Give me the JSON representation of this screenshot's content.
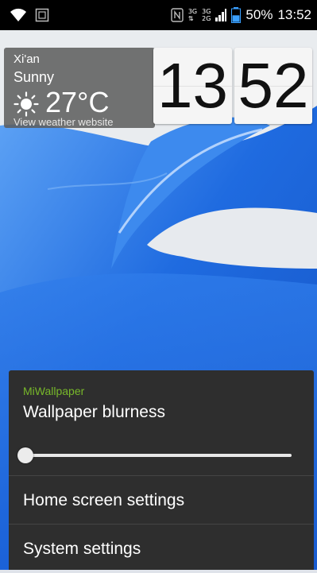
{
  "status_bar": {
    "battery_text": "50%",
    "time": "13:52",
    "network_top": "3G",
    "network_bottom": "2G",
    "network_label_left": "3G",
    "network_arrows": "⇅",
    "icons": [
      "wifi-icon",
      "screenshot-icon",
      "nfc-icon",
      "signal-icon",
      "battery-icon"
    ],
    "battery_level": 0.5
  },
  "weather": {
    "city": "Xi'an",
    "condition": "Sunny",
    "temperature": "27°C",
    "link": "View weather website",
    "icon": "sun-icon"
  },
  "clock": {
    "hours": "13",
    "minutes": "52"
  },
  "panel": {
    "app_name": "MiWallpaper",
    "setting_title": "Wallpaper blurness",
    "blur_level": 0.0,
    "items": [
      {
        "label": "Home screen settings"
      },
      {
        "label": "System settings"
      }
    ]
  },
  "colors": {
    "accent_green": "#78b82a",
    "panel_bg": "#2e2e2e",
    "wallpaper_blue": "#1f6be0"
  }
}
